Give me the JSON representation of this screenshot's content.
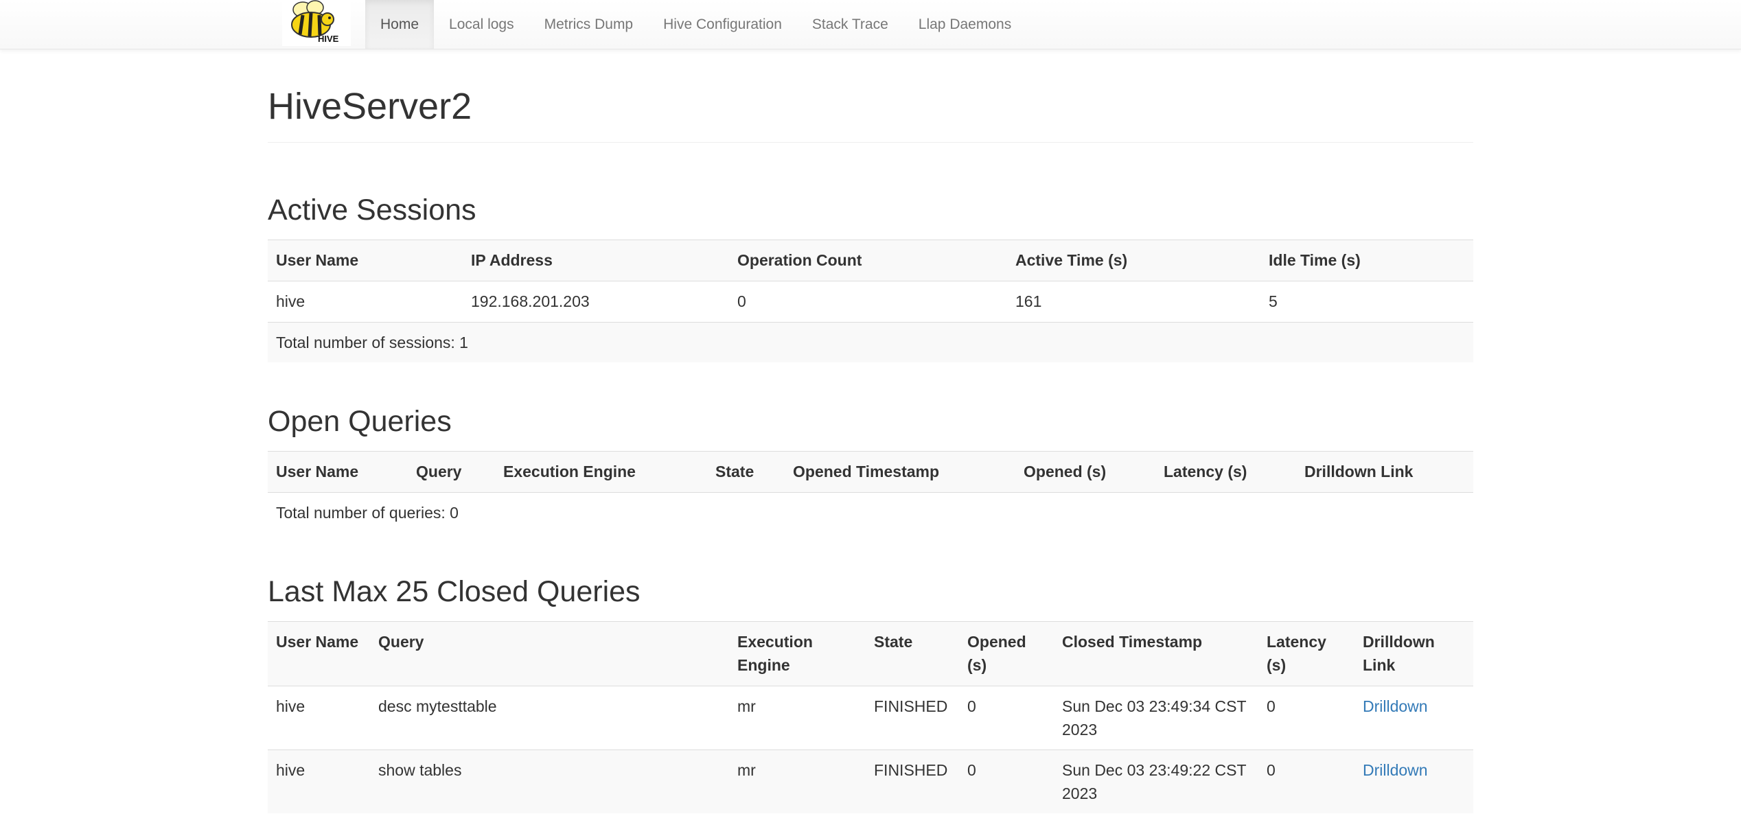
{
  "nav": {
    "logo_text": "HIVE",
    "items": [
      "Home",
      "Local logs",
      "Metrics Dump",
      "Hive Configuration",
      "Stack Trace",
      "Llap Daemons"
    ],
    "active": "Home"
  },
  "page_title": "HiveServer2",
  "active_sessions": {
    "title": "Active Sessions",
    "headers": [
      "User Name",
      "IP Address",
      "Operation Count",
      "Active Time (s)",
      "Idle Time (s)"
    ],
    "rows": [
      [
        "hive",
        "192.168.201.203",
        "0",
        "161",
        "5"
      ]
    ],
    "footer": "Total number of sessions: 1"
  },
  "open_queries": {
    "title": "Open Queries",
    "headers": [
      "User Name",
      "Query",
      "Execution Engine",
      "State",
      "Opened Timestamp",
      "Opened (s)",
      "Latency (s)",
      "Drilldown Link"
    ],
    "footer": "Total number of queries: 0"
  },
  "closed_queries": {
    "title": "Last Max 25 Closed Queries",
    "headers": [
      "User Name",
      "Query",
      "Execution Engine",
      "State",
      "Opened (s)",
      "Closed Timestamp",
      "Latency (s)",
      "Drilldown Link"
    ],
    "rows": [
      [
        "hive",
        "desc mytesttable",
        "mr",
        "FINISHED",
        "0",
        "Sun Dec 03 23:49:34 CST 2023",
        "0",
        "Drilldown"
      ],
      [
        "hive",
        "show tables",
        "mr",
        "FINISHED",
        "0",
        "Sun Dec 03 23:49:22 CST 2023",
        "0",
        "Drilldown"
      ]
    ]
  },
  "colors": {
    "link": "#337ab7",
    "logo_yellow": "#f5d416"
  }
}
